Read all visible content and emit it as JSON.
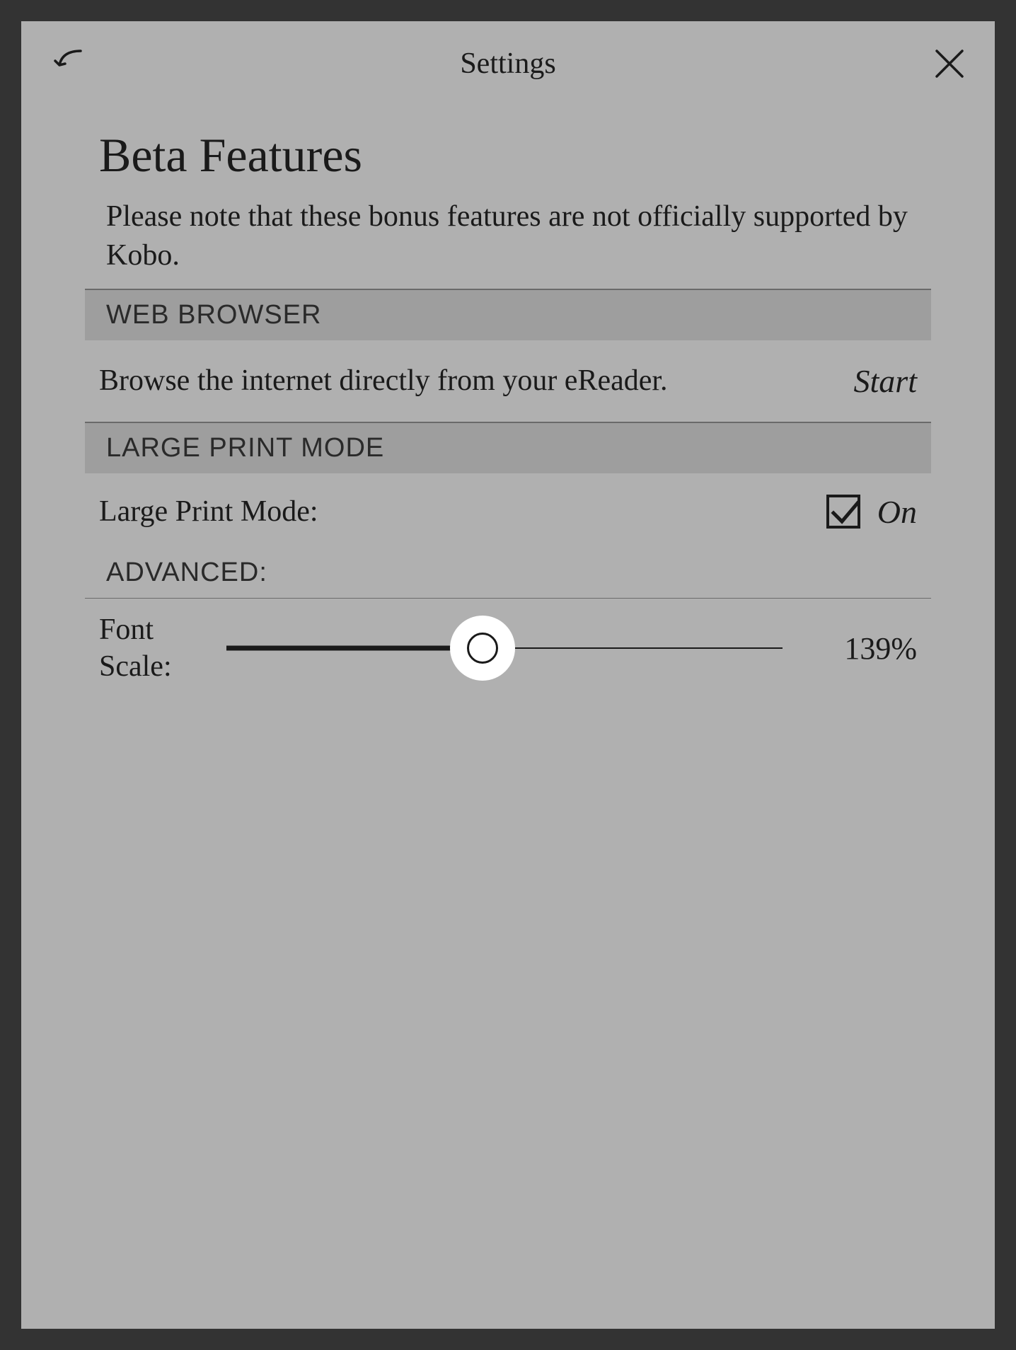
{
  "header": {
    "title": "Settings"
  },
  "page": {
    "title": "Beta Features",
    "subtitle": "Please note that these bonus features are not officially supported by Kobo."
  },
  "sections": {
    "web_browser": {
      "header": "WEB BROWSER",
      "description": "Browse the internet directly from your eReader.",
      "action_label": "Start"
    },
    "large_print": {
      "header": "LARGE PRINT MODE",
      "label": "Large Print Mode:",
      "checked": true,
      "state_label": "On",
      "advanced_label": "ADVANCED:",
      "font_scale": {
        "label": "Font Scale:",
        "value_text": "139%",
        "percent": 46
      }
    }
  }
}
